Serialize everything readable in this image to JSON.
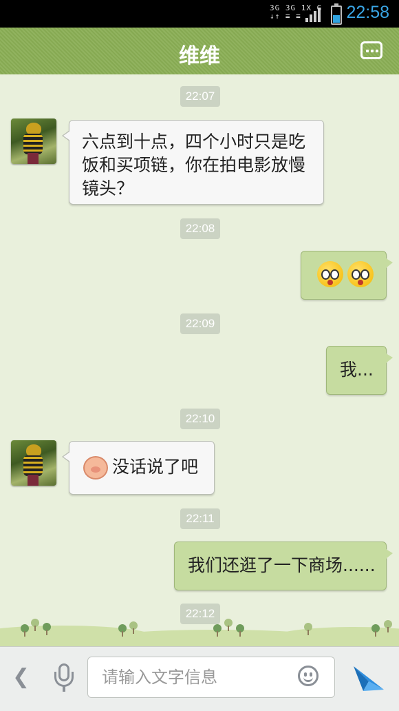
{
  "status_bar": {
    "network": "3G 3G 1X G",
    "clock": "22:58",
    "battery_level": 0.45
  },
  "header": {
    "title": "维维"
  },
  "messages": [
    {
      "type": "time",
      "text": "22:07"
    },
    {
      "type": "received",
      "text": "六点到十点，四个小时只是吃饭和买项链，你在拍电影放慢镜头？"
    },
    {
      "type": "time",
      "text": "22:08"
    },
    {
      "type": "sent",
      "emoji": [
        "shocked-face",
        "shocked-face"
      ]
    },
    {
      "type": "time",
      "text": "22:09"
    },
    {
      "type": "sent",
      "text": "我..."
    },
    {
      "type": "time",
      "text": "22:10"
    },
    {
      "type": "received",
      "emoji": "pig-face",
      "text": "没话说了吧"
    },
    {
      "type": "time",
      "text": "22:11"
    },
    {
      "type": "sent",
      "text": "我们还逛了一下商场......"
    },
    {
      "type": "time",
      "text": "22:12"
    }
  ],
  "input_bar": {
    "placeholder": "请输入文字信息"
  },
  "colors": {
    "header": "#8aae55",
    "sent_bubble": "#c6dca0",
    "received_bubble": "#f7f7f7",
    "send": "#2f8fe0"
  }
}
